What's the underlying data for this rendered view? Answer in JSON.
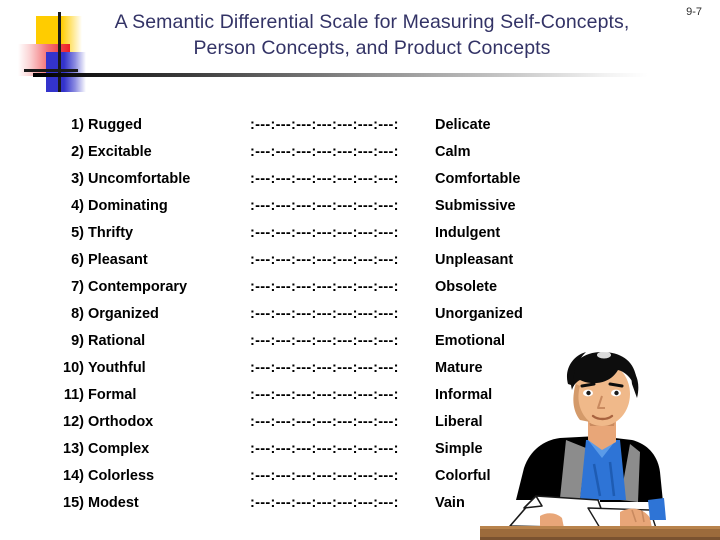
{
  "page_number": "9-7",
  "title": "A Semantic Differential Scale for Measuring Self-Concepts, Person Concepts, and Product Concepts",
  "scale_marker": ":---:---:---:---:---:---:---:",
  "items": [
    {
      "num": "1)",
      "left": "Rugged",
      "scale": ":---:---:---:---:---:---:---:",
      "right": "Delicate"
    },
    {
      "num": "2)",
      "left": "Excitable",
      "scale": ":---:---:---:---:---:---:---:",
      "right": "Calm"
    },
    {
      "num": "3)",
      "left": "Uncomfortable",
      "scale": ":---:---:---:---:---:---:---:",
      "right": "Comfortable"
    },
    {
      "num": "4)",
      "left": "Dominating",
      "scale": ":---:---:---:---:---:---:---:",
      "right": "Submissive"
    },
    {
      "num": "5)",
      "left": "Thrifty",
      "scale": ":---:---:---:---:---:---:---:",
      "right": "Indulgent"
    },
    {
      "num": "6)",
      "left": "Pleasant",
      "scale": ":---:---:---:---:---:---:---:",
      "right": "Unpleasant"
    },
    {
      "num": "7)",
      "left": "Contemporary",
      "scale": ":---:---:---:---:---:---:---:",
      "right": "Obsolete"
    },
    {
      "num": "8)",
      "left": "Organized",
      "scale": ":---:---:---:---:---:---:---:",
      "right": "Unorganized"
    },
    {
      "num": "9)",
      "left": "Rational",
      "scale": ":---:---:---:---:---:---:---:",
      "right": "Emotional"
    },
    {
      "num": "10)",
      "left": "Youthful",
      "scale": ":---:---:---:---:---:---:---:",
      "right": "Mature"
    },
    {
      "num": "11)",
      "left": "Formal",
      "scale": ":---:---:---:---:---:---:---:",
      "right": "Informal"
    },
    {
      "num": "12)",
      "left": "Orthodox",
      "scale": ":---:---:---:---:---:---:---:",
      "right": "Liberal"
    },
    {
      "num": "13)",
      "left": "Complex",
      "scale": ":---:---:---:---:---:---:---:",
      "right": "Simple"
    },
    {
      "num": "14)",
      "left": "Colorless",
      "scale": ":---:---:---:---:---:---:---:",
      "right": "Colorful"
    },
    {
      "num": "15)",
      "left": "Modest",
      "scale": ":---:---:---:---:---:---:---:",
      "right": "Vain"
    }
  ],
  "colors": {
    "title": "#333366",
    "logo_yellow": "#FFCC00",
    "logo_red": "#ED1C24",
    "logo_blue": "#3333CC",
    "text": "#000000",
    "desk": "#9C6B3C"
  },
  "illustration": {
    "alt": "clipart of a person in a dark jacket and blue shirt seated at a desk with papers"
  }
}
